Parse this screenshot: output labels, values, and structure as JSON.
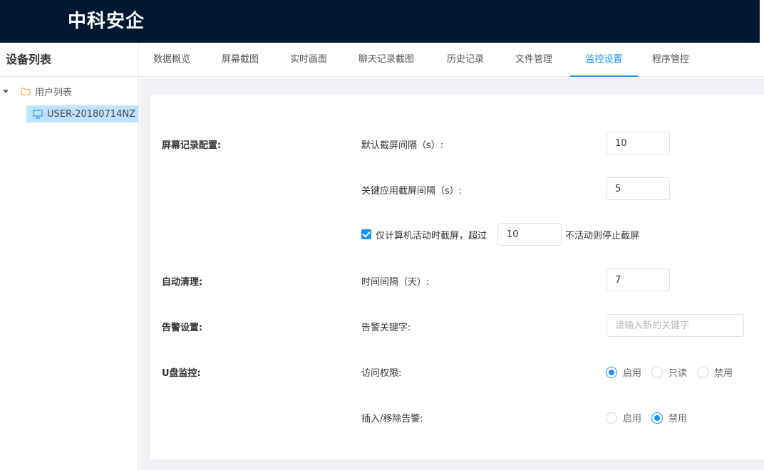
{
  "header": {
    "brand": "中科安企"
  },
  "sidebar": {
    "title": "设备列表",
    "tree": {
      "root_label": "用户列表",
      "root_icon": "folder-icon",
      "child_label": "USER-20180714NZ",
      "child_icon": "monitor-icon"
    }
  },
  "tabs": [
    "数据概览",
    "屏幕截图",
    "实时画面",
    "聊天记录截图",
    "历史记录",
    "文件管理",
    "监控设置",
    "程序管控"
  ],
  "active_tab": "监控设置",
  "settings": {
    "screen_record": {
      "section": "屏幕记录配置:",
      "default_interval_label": "默认截屏间隔（s）:",
      "default_interval_value": "10",
      "key_app_interval_label": "关键应用截屏间隔（s）:",
      "key_app_interval_value": "5",
      "active_only_checked": true,
      "active_only_prefix": "仅计算机活动时截屏，超过",
      "active_only_value": "10",
      "active_only_suffix": "不活动则停止截屏"
    },
    "auto_clean": {
      "section": "自动清理:",
      "interval_label": "时间间隔（天）:",
      "interval_value": "7"
    },
    "alert": {
      "section": "告警设置:",
      "keyword_label": "告警关键字:",
      "keyword_placeholder": "请输入新的关键字",
      "keyword_value": ""
    },
    "usb": {
      "section": "U盘监控:",
      "access_label": "访问权限:",
      "access_options": [
        "启用",
        "只读",
        "禁用"
      ],
      "access_selected": "启用",
      "insert_alert_label": "插入/移除告警:",
      "insert_alert_options": [
        "启用",
        "禁用"
      ],
      "insert_alert_selected": "禁用"
    }
  },
  "colors": {
    "header_bg": "#031731",
    "accent": "#1890ff",
    "selected_row": "#bfe3ff",
    "content_bg": "#f0f2f5"
  }
}
